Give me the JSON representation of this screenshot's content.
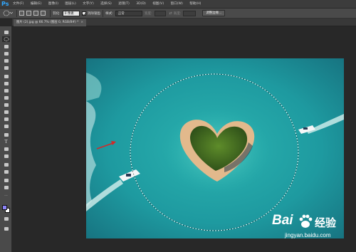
{
  "app": {
    "logo": "Ps"
  },
  "menu": [
    "文件(F)",
    "编辑(E)",
    "图像(I)",
    "图层(L)",
    "文字(Y)",
    "选择(S)",
    "滤镜(T)",
    "3D(D)",
    "视图(V)",
    "窗口(W)",
    "帮助(H)"
  ],
  "options": {
    "feather_label": "羽化:",
    "feather_value": "0 像素",
    "antialias_label": "消除锯齿",
    "antialias_checked": true,
    "style_label": "样式:",
    "style_value": "正常",
    "width_label": "宽度:",
    "height_label": "高度:",
    "refine_edge_label": "调整边缘..."
  },
  "document": {
    "tab_label": "图片 (2).jpg @ 66.7% (图层 0, RGB/8#) *",
    "close_label": "×"
  },
  "colors": {
    "foreground": "#8a82f5",
    "background": "#ffffff",
    "accent": "#31a8ff",
    "sea": "#1e9aa0",
    "sand": "#e2b98c",
    "palm": "#3f6b22"
  },
  "watermark": {
    "brand_left": "Bai",
    "brand_right": "经验",
    "url": "jingyan.baidu.com"
  }
}
